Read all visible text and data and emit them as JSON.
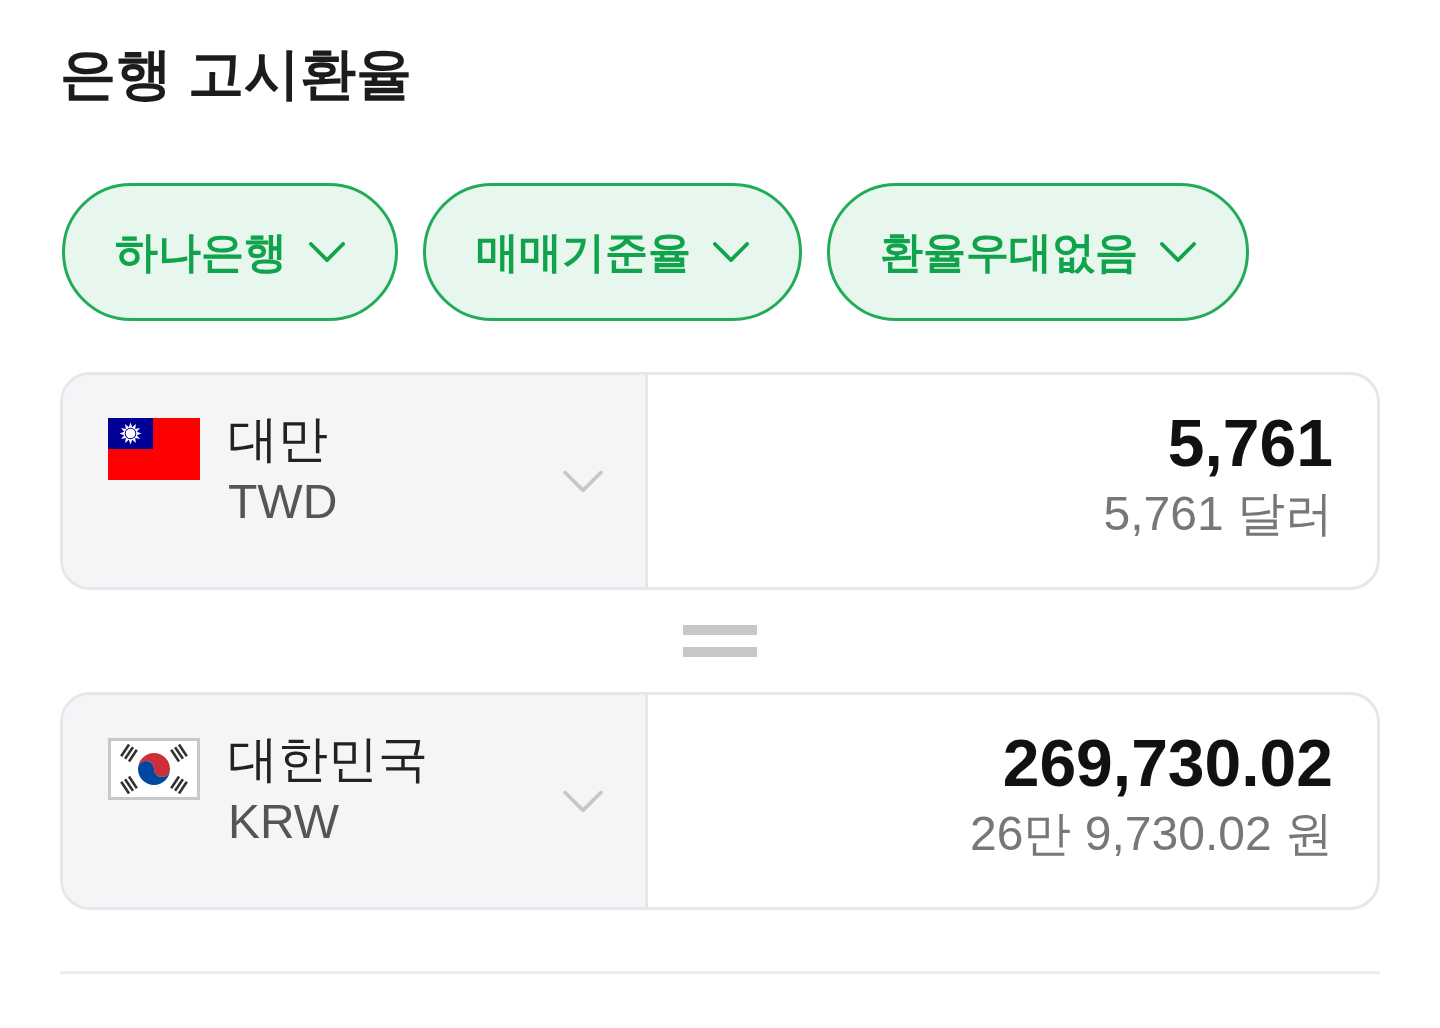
{
  "title": "은행 고시환율",
  "filters": [
    {
      "label": "하나은행"
    },
    {
      "label": "매매기준율"
    },
    {
      "label": "환율우대없음"
    }
  ],
  "conversions": [
    {
      "kind": "taiwan",
      "country": "대만",
      "code": "TWD",
      "amount": "5,761",
      "amount_text": "5,761 달러"
    },
    {
      "kind": "korea",
      "country": "대한민국",
      "code": "KRW",
      "amount": "269,730.02",
      "amount_text": "26만 9,730.02 원"
    }
  ]
}
